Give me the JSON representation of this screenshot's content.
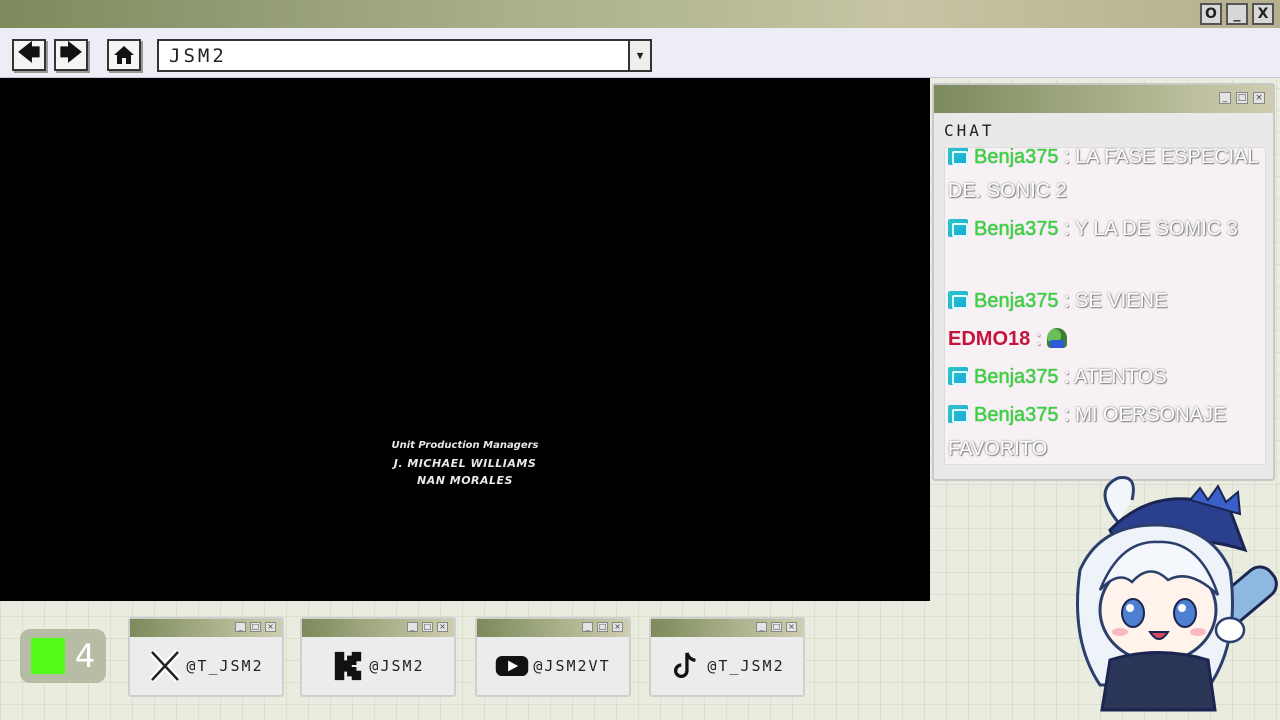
{
  "window_controls": [
    "O",
    "_",
    "X"
  ],
  "nav": {
    "back_icon": "arrow-left-icon",
    "forward_icon": "arrow-right-icon",
    "home_icon": "home-icon",
    "address_value": "JSM2"
  },
  "video": {
    "credits": {
      "role": "Unit Production Managers",
      "names": [
        "J. MICHAEL WILLIAMS",
        "NAN MORALES"
      ]
    }
  },
  "chat": {
    "title": "CHAT",
    "messages": [
      {
        "user": "Benja375",
        "sep": " : ",
        "text": "LA FASE ESPECIAL DE. SONIC 2",
        "badge": true,
        "user_color": "#35d43a"
      },
      {
        "user": "Benja375",
        "sep": " : ",
        "text": "Y LA DE SOMIC 3",
        "badge": true,
        "user_color": "#35d43a"
      },
      {
        "user": "Benja375",
        "sep": " : ",
        "text": "SE VIENE",
        "badge": true,
        "user_color": "#35d43a"
      },
      {
        "user": "EDMO18",
        "sep": " : ",
        "text": "",
        "badge": false,
        "emote": "pepe-emote",
        "user_color": "#c4143c"
      },
      {
        "user": "Benja375",
        "sep": " : ",
        "text": "ATENTOS",
        "badge": true,
        "user_color": "#35d43a"
      },
      {
        "user": "Benja375",
        "sep": " : ",
        "text": "MI OERSONAJE FAVORITO",
        "badge": true,
        "user_color": "#35d43a"
      }
    ]
  },
  "kick_counter": {
    "icon": "kick-logo-icon",
    "count": "4",
    "accent": "#53fc18"
  },
  "socials": [
    {
      "icon": "x-logo-icon",
      "handle": "@T_JSM2"
    },
    {
      "icon": "kick-logo-icon",
      "handle": "@JSM2"
    },
    {
      "icon": "youtube-logo-icon",
      "handle": "@JSM2VT"
    },
    {
      "icon": "tiktok-logo-icon",
      "handle": "@T_JSM2"
    }
  ],
  "colors": {
    "frame_green": "#7c8a5c",
    "background": "#e9ecdf"
  }
}
